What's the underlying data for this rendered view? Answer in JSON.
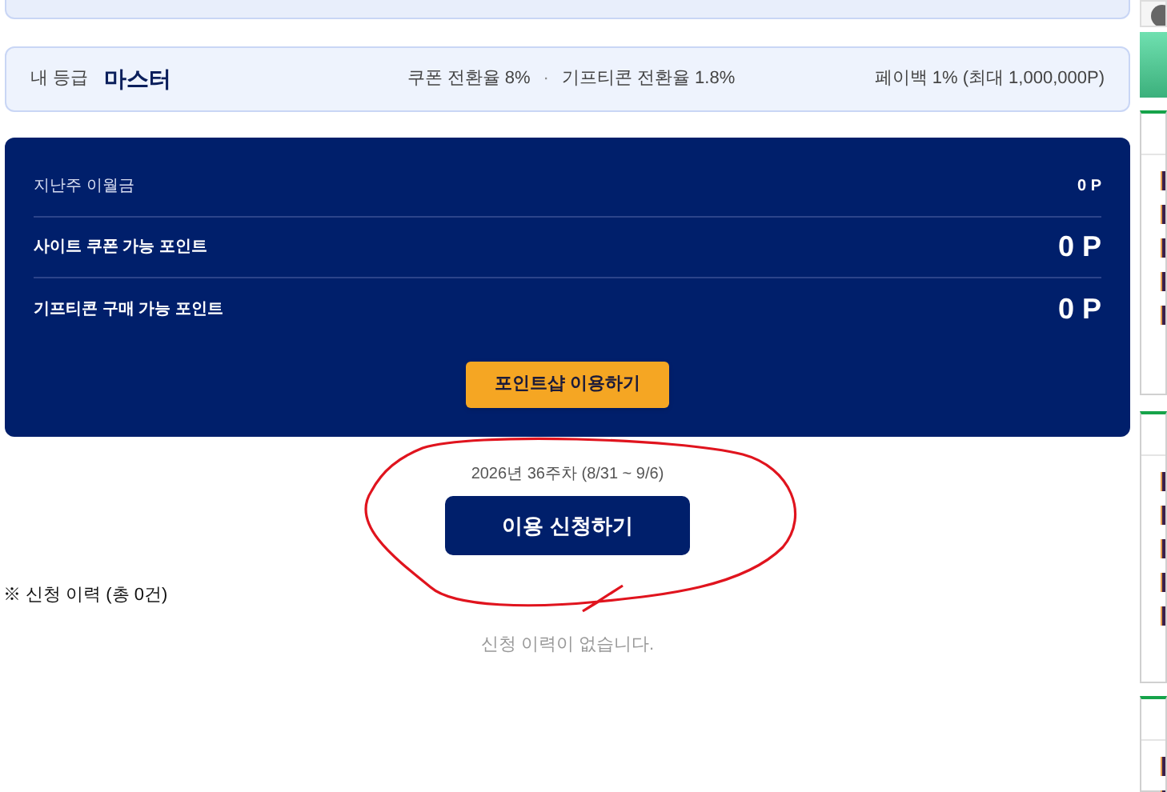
{
  "grade": {
    "label": "내 등급",
    "name": "마스터",
    "rates": [
      "쿠폰 전환율 8%",
      "기프티콘 전환율 1.8%"
    ],
    "separator": "·",
    "payback": "페이백 1% (최대 1,000,000P)"
  },
  "points": {
    "rows": [
      {
        "kind": "minor",
        "label": "지난주 이월금",
        "value": "0 P"
      },
      {
        "kind": "major",
        "label": "사이트 쿠폰 가능 포인트",
        "value": "0 P"
      },
      {
        "kind": "major",
        "label": "기프티콘 구매 가능 포인트",
        "value": "0 P"
      }
    ],
    "button": "포인트샵 이용하기"
  },
  "apply": {
    "week": "2026년 36주차 (8/31 ~ 9/6)",
    "button": "이용 신청하기"
  },
  "history": {
    "label": "※ 신청 이력 (총 0건)",
    "empty": "신청 이력이 없습니다."
  }
}
